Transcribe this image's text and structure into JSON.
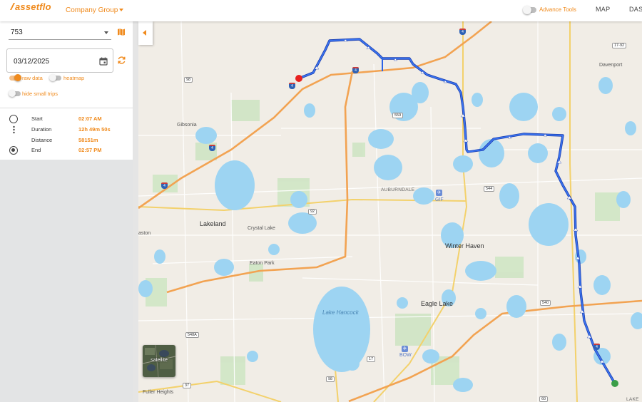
{
  "header": {
    "logo": "assetflo",
    "company_selector": "Company Group",
    "advance_tools_label": "Advance Tools",
    "nav": {
      "map": "MAP",
      "dashboard": "DAS"
    }
  },
  "sidebar": {
    "asset_value": "753",
    "date_value": "03/12/2025",
    "toggles": {
      "raw_data": {
        "label": "raw data",
        "on": true
      },
      "heatmap": {
        "label": "heatmap",
        "on": false
      },
      "hide_small_trips": {
        "label": "hide small trips",
        "on": false
      }
    },
    "trip": {
      "start_label": "Start",
      "start_value": "02:07 AM",
      "duration_label": "Duration",
      "duration_value": "12h 49m 50s",
      "distance_label": "Distance",
      "distance_value": "58151m",
      "end_label": "End",
      "end_value": "02:57 PM"
    }
  },
  "map": {
    "satellite_label": "satellite",
    "places": {
      "davenport": "Davenport",
      "gibsonia": "Gibsonia",
      "lakeland": "Lakeland",
      "crystal_lake": "Crystal Lake",
      "eaton_park": "Eaton Park",
      "lake_hancock": "Lake Hancock",
      "winter_haven": "Winter Haven",
      "eagle_lake": "Eagle Lake",
      "auburndale": "AUBURNDALE",
      "fuller_heights": "Fuller Heights",
      "aston": "aston",
      "lake_partial": "LAKE"
    },
    "airports": {
      "gif": "GIF",
      "bow": "BOW"
    },
    "route_shields": {
      "r98_north": "98",
      "r559": "559",
      "r544": "544",
      "r92": "92",
      "r540": "540",
      "r548a": "548A",
      "r37": "37",
      "r98_south": "98",
      "r17": "17",
      "r17_92": "17-92",
      "r60": "60"
    },
    "interstates": {
      "i4": "4"
    },
    "colors": {
      "route": "#2b63e6",
      "start_marker": "#e8201f",
      "end_marker": "#3b9e48",
      "water": "#9dd4f2"
    }
  }
}
